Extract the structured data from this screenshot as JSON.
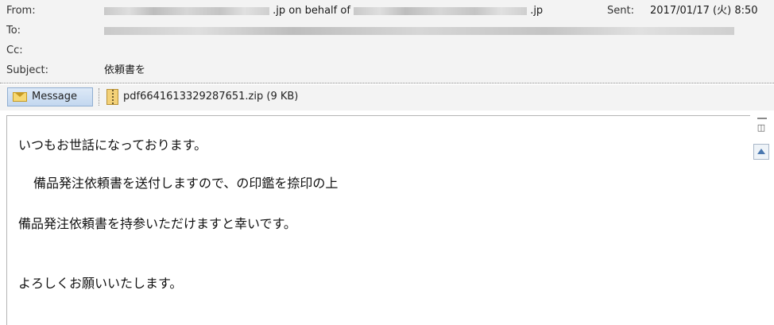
{
  "header": {
    "from_label": "From:",
    "from_mid": ".jp on behalf of",
    "from_end": ".jp",
    "to_label": "To:",
    "cc_label": "Cc:",
    "subject_label": "Subject:",
    "subject": "依頼書を",
    "sent_label": "Sent:",
    "sent_value": "2017/01/17 (火) 8:50"
  },
  "tabs": {
    "message_label": "Message",
    "attachment_name": "pdf6641613329287651.zip (9 KB)"
  },
  "body": {
    "line1": "いつもお世話になっております。",
    "line2": "備品発注依頼書を送付しますので、の印鑑を捺印の上",
    "line3": "備品発注依頼書を持参いただけますと幸いです。",
    "line4": "よろしくお願いいたします。"
  },
  "icons": {
    "envelope": "envelope-icon",
    "zip": "zip-file-icon",
    "scroll_up": "arrow-up-icon"
  },
  "colors": {
    "header_bg": "#f3f3f3",
    "tab_blue": "#c3d7ef"
  }
}
